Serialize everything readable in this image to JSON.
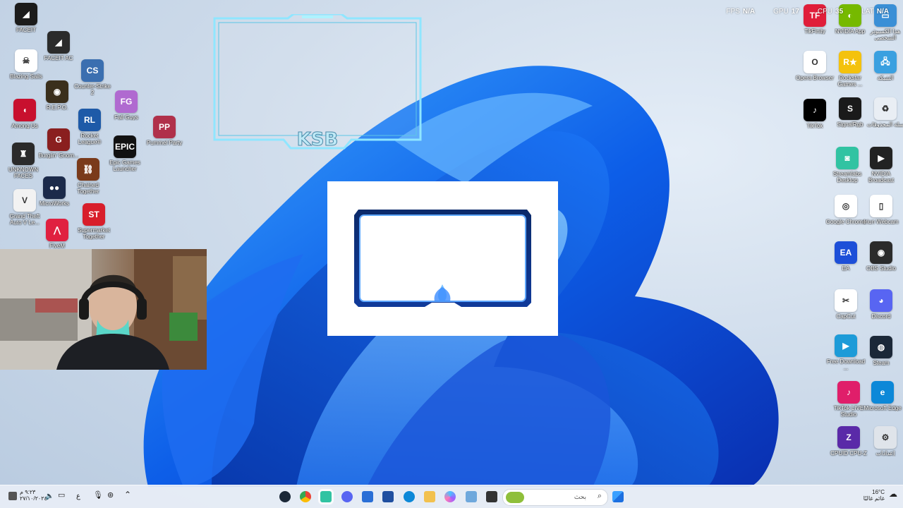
{
  "hud": {
    "fps_label": "FPS",
    "fps_value": "N/A",
    "gpu_label": "GPU",
    "gpu_value": "17",
    "cpu_label": "CPU",
    "cpu_value": "35",
    "lat_label": "LAT",
    "lat_value": "N/A"
  },
  "overlay": {
    "frame_logo": "KSB"
  },
  "desktop_icons_left": [
    {
      "label": "FACEIT",
      "color": "#1b1b1b",
      "glyph": "◢"
    },
    {
      "label": "FACEIT AC",
      "color": "#2b2b2b",
      "glyph": "◢"
    },
    {
      "label": "Blazing Sails",
      "color": "#ffffff",
      "glyph": "☠"
    },
    {
      "label": "R.E.P.O.",
      "color": "#3a2f1c",
      "glyph": "◉"
    },
    {
      "label": "Counter-Strike 2",
      "color": "#3b6fb0",
      "glyph": "CS"
    },
    {
      "label": "Among Us",
      "color": "#c8102e",
      "glyph": "◖"
    },
    {
      "label": "Rocket League®",
      "color": "#1e5aa8",
      "glyph": "RL"
    },
    {
      "label": "Fall Guys",
      "color": "#b06ad0",
      "glyph": "FG"
    },
    {
      "label": "UNKNOWN FACES",
      "color": "#2a2a2a",
      "glyph": "♜"
    },
    {
      "label": "Burglin' Gnom...",
      "color": "#8a1f1f",
      "glyph": "G"
    },
    {
      "label": "Chained Together",
      "color": "#7a3a1a",
      "glyph": "⛓"
    },
    {
      "label": "Epic Games Launcher",
      "color": "#111111",
      "glyph": "EPIC"
    },
    {
      "label": "Pummel Party",
      "color": "#b0304a",
      "glyph": "PP"
    },
    {
      "label": "Grand Theft Auto V Le...",
      "color": "#f2f2f2",
      "glyph": "V"
    },
    {
      "label": "MicroWorks",
      "color": "#1b2a4a",
      "glyph": "●●"
    },
    {
      "label": "Supermarket Together",
      "color": "#d81e2b",
      "glyph": "ST"
    },
    {
      "label": "FiveM",
      "color": "#e02040",
      "glyph": "⋀"
    }
  ],
  "desktop_icons_right": [
    {
      "label": "TikFinity",
      "color": "#e01e3a",
      "glyph": "TF"
    },
    {
      "label": "NVIDIA App",
      "color": "#76b900",
      "glyph": "◐"
    },
    {
      "label": "هذا الكمبيوتر الشخصي",
      "color": "#3a8fd6",
      "glyph": "▭"
    },
    {
      "label": "Opera Browser",
      "color": "#ffffff",
      "glyph": "O"
    },
    {
      "label": "Rockstar Games ...",
      "color": "#f4c20d",
      "glyph": "R★"
    },
    {
      "label": "الشبكة",
      "color": "#3aa0e0",
      "glyph": "🖧"
    },
    {
      "label": "TikTok",
      "color": "#000000",
      "glyph": "♪"
    },
    {
      "label": "SignalRgb",
      "color": "#1a1a1a",
      "glyph": "S"
    },
    {
      "label": "سلة المحذوفات",
      "color": "#e9eef4",
      "glyph": "♻"
    },
    {
      "label": "Streamlabs Desktop",
      "color": "#31c3a2",
      "glyph": "◙"
    },
    {
      "label": "NVIDIA Broadcast",
      "color": "#222222",
      "glyph": "▶"
    },
    {
      "label": "Google Chrome",
      "color": "#ffffff",
      "glyph": "◎"
    },
    {
      "label": "Iriun Webcam",
      "color": "#ffffff",
      "glyph": "▯"
    },
    {
      "label": "EA",
      "color": "#1d4fd8",
      "glyph": "EA"
    },
    {
      "label": "OBS Studio",
      "color": "#2b2b2b",
      "glyph": "◉"
    },
    {
      "label": "CapCut",
      "color": "#ffffff",
      "glyph": "✂"
    },
    {
      "label": "Discord",
      "color": "#5865f2",
      "glyph": "◕"
    },
    {
      "label": "Free Download ...",
      "color": "#1d9bd8",
      "glyph": "▶"
    },
    {
      "label": "Steam",
      "color": "#1b2838",
      "glyph": "◍"
    },
    {
      "label": "TikTok LIVE Studio",
      "color": "#e01e6a",
      "glyph": "♪"
    },
    {
      "label": "Microsoft Edge",
      "color": "#0c88d8",
      "glyph": "e"
    },
    {
      "label": "CPUID CPU-Z",
      "color": "#5a2aa8",
      "glyph": "Z"
    },
    {
      "label": "إعدادات",
      "color": "#dfe4ea",
      "glyph": "⚙"
    }
  ],
  "taskbar": {
    "search_placeholder": "بحث",
    "weather_temp": "16°C",
    "weather_text": "غائم غالبًا",
    "clock_time": "٩:٢٣ م",
    "clock_date": "٢٧/١٠/٢٠٢٤",
    "lang": "ع"
  }
}
